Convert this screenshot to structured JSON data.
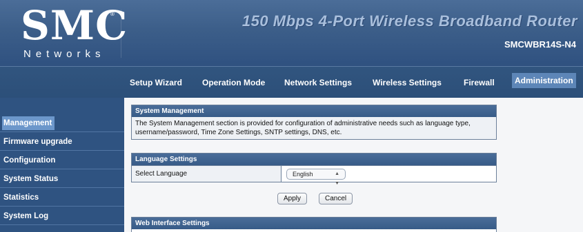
{
  "header": {
    "logo_main": "SMC",
    "logo_reg": "®",
    "logo_sub": "Networks",
    "product_title": "150 Mbps 4-Port Wireless Broadband Router",
    "model": "SMCWBR14S-N4"
  },
  "topnav": {
    "items": [
      {
        "label": "Setup Wizard",
        "active": false
      },
      {
        "label": "Operation Mode",
        "active": false
      },
      {
        "label": "Network Settings",
        "active": false
      },
      {
        "label": "Wireless Settings",
        "active": false
      },
      {
        "label": "Firewall",
        "active": false
      },
      {
        "label": "Administration",
        "active": true
      }
    ]
  },
  "sidebar": {
    "items": [
      {
        "label": "Management",
        "active": true
      },
      {
        "label": "Firmware upgrade",
        "active": false
      },
      {
        "label": "Configuration",
        "active": false
      },
      {
        "label": "System Status",
        "active": false
      },
      {
        "label": "Statistics",
        "active": false
      },
      {
        "label": "System Log",
        "active": false
      }
    ]
  },
  "system_management": {
    "title": "System Management",
    "description": "The System Management section is provided for configuration of administrative needs such as language type, username/password, Time Zone Settings, SNTP settings, DNS, etc."
  },
  "language_settings": {
    "title": "Language Settings",
    "select_label": "Select Language",
    "selected_value": "English"
  },
  "buttons": {
    "apply": "Apply",
    "cancel": "Cancel"
  },
  "web_interface": {
    "title": "Web Interface Settings"
  },
  "colors": {
    "header_bg": "#3c5e89",
    "nav_bg": "#2f5381",
    "active_highlight": "#6c97cb",
    "section_head": "#4a6d99"
  }
}
